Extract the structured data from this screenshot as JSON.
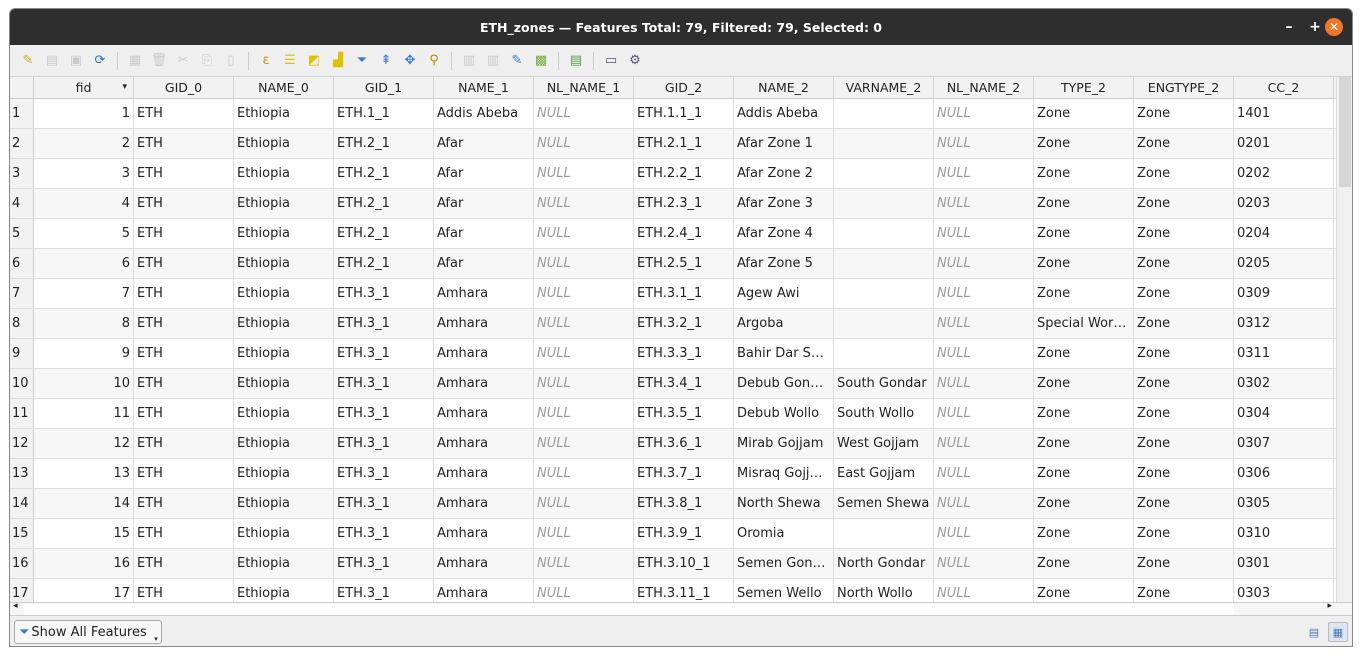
{
  "window": {
    "title": "ETH_zones — Features Total: 79, Filtered: 79, Selected: 0",
    "minimize": "–",
    "maximize": "+",
    "close": "✕"
  },
  "toolbar": [
    {
      "name": "toggle-editing-icon",
      "glyph": "✎",
      "color": "#d8b020",
      "enabled": true
    },
    {
      "name": "toggle-multi-edit-icon",
      "glyph": "▤",
      "color": "#888",
      "enabled": false
    },
    {
      "name": "save-edits-icon",
      "glyph": "▣",
      "color": "#888",
      "enabled": false
    },
    {
      "name": "reload-icon",
      "glyph": "⟳",
      "color": "#2e6fc7",
      "enabled": true
    },
    {
      "sep": true
    },
    {
      "name": "add-feature-icon",
      "glyph": "▦",
      "color": "#888",
      "enabled": false
    },
    {
      "name": "delete-selected-icon",
      "glyph": "🗑",
      "color": "#888",
      "enabled": false
    },
    {
      "name": "cut-icon",
      "glyph": "✂",
      "color": "#888",
      "enabled": false
    },
    {
      "name": "copy-icon",
      "glyph": "⎘",
      "color": "#888",
      "enabled": false
    },
    {
      "name": "paste-icon",
      "glyph": "▯",
      "color": "#888",
      "enabled": false
    },
    {
      "sep": true
    },
    {
      "name": "select-by-expression-icon",
      "glyph": "ε",
      "color": "#c89a00",
      "enabled": true
    },
    {
      "name": "select-all-icon",
      "glyph": "☰",
      "color": "#e0c000",
      "enabled": true
    },
    {
      "name": "invert-selection-icon",
      "glyph": "◩",
      "color": "#e0c000",
      "enabled": true
    },
    {
      "name": "deselect-all-icon",
      "glyph": "▟",
      "color": "#e0c000",
      "enabled": true
    },
    {
      "name": "filter-icon",
      "glyph": "⏷",
      "color": "#3a7ad0",
      "enabled": true
    },
    {
      "name": "move-selection-top-icon",
      "glyph": "⇞",
      "color": "#3a7ad0",
      "enabled": true
    },
    {
      "name": "pan-to-selected-icon",
      "glyph": "✥",
      "color": "#3a7ad0",
      "enabled": true
    },
    {
      "name": "zoom-to-selected-icon",
      "glyph": "⚲",
      "color": "#b08a00",
      "enabled": true
    },
    {
      "sep": true
    },
    {
      "name": "new-field-icon",
      "glyph": "▥",
      "color": "#888",
      "enabled": false
    },
    {
      "name": "delete-field-icon",
      "glyph": "▥",
      "color": "#888",
      "enabled": false
    },
    {
      "name": "organize-columns-icon",
      "glyph": "✎",
      "color": "#3a7ad0",
      "enabled": true
    },
    {
      "name": "field-calculator-icon",
      "glyph": "▩",
      "color": "#7a4",
      "enabled": true
    },
    {
      "sep": true
    },
    {
      "name": "conditional-formatting-icon",
      "glyph": "▤",
      "color": "#5a9a50",
      "enabled": true
    },
    {
      "sep": true
    },
    {
      "name": "dock-icon",
      "glyph": "▭",
      "color": "#557",
      "enabled": true
    },
    {
      "name": "actions-icon",
      "glyph": "⚙",
      "color": "#557",
      "enabled": true
    }
  ],
  "columns": [
    "fid",
    "GID_0",
    "NAME_0",
    "GID_1",
    "NAME_1",
    "NL_NAME_1",
    "GID_2",
    "NAME_2",
    "VARNAME_2",
    "NL_NAME_2",
    "TYPE_2",
    "ENGTYPE_2",
    "CC_2"
  ],
  "rows": [
    [
      "1",
      "1",
      "ETH",
      "Ethiopia",
      "ETH.1_1",
      "Addis Abeba",
      "NULL",
      "ETH.1.1_1",
      "Addis Abeba",
      "",
      "NULL",
      "Zone",
      "Zone",
      "1401"
    ],
    [
      "2",
      "2",
      "ETH",
      "Ethiopia",
      "ETH.2_1",
      "Afar",
      "NULL",
      "ETH.2.1_1",
      "Afar Zone 1",
      "",
      "NULL",
      "Zone",
      "Zone",
      "0201"
    ],
    [
      "3",
      "3",
      "ETH",
      "Ethiopia",
      "ETH.2_1",
      "Afar",
      "NULL",
      "ETH.2.2_1",
      "Afar Zone 2",
      "",
      "NULL",
      "Zone",
      "Zone",
      "0202"
    ],
    [
      "4",
      "4",
      "ETH",
      "Ethiopia",
      "ETH.2_1",
      "Afar",
      "NULL",
      "ETH.2.3_1",
      "Afar Zone 3",
      "",
      "NULL",
      "Zone",
      "Zone",
      "0203"
    ],
    [
      "5",
      "5",
      "ETH",
      "Ethiopia",
      "ETH.2_1",
      "Afar",
      "NULL",
      "ETH.2.4_1",
      "Afar Zone 4",
      "",
      "NULL",
      "Zone",
      "Zone",
      "0204"
    ],
    [
      "6",
      "6",
      "ETH",
      "Ethiopia",
      "ETH.2_1",
      "Afar",
      "NULL",
      "ETH.2.5_1",
      "Afar Zone 5",
      "",
      "NULL",
      "Zone",
      "Zone",
      "0205"
    ],
    [
      "7",
      "7",
      "ETH",
      "Ethiopia",
      "ETH.3_1",
      "Amhara",
      "NULL",
      "ETH.3.1_1",
      "Agew Awi",
      "",
      "NULL",
      "Zone",
      "Zone",
      "0309"
    ],
    [
      "8",
      "8",
      "ETH",
      "Ethiopia",
      "ETH.3_1",
      "Amhara",
      "NULL",
      "ETH.3.2_1",
      "Argoba",
      "",
      "NULL",
      "Special Wor…",
      "Zone",
      "0312"
    ],
    [
      "9",
      "9",
      "ETH",
      "Ethiopia",
      "ETH.3_1",
      "Amhara",
      "NULL",
      "ETH.3.3_1",
      "Bahir Dar S…",
      "",
      "NULL",
      "Zone",
      "Zone",
      "0311"
    ],
    [
      "10",
      "10",
      "ETH",
      "Ethiopia",
      "ETH.3_1",
      "Amhara",
      "NULL",
      "ETH.3.4_1",
      "Debub Gon…",
      "South Gondar",
      "NULL",
      "Zone",
      "Zone",
      "0302"
    ],
    [
      "11",
      "11",
      "ETH",
      "Ethiopia",
      "ETH.3_1",
      "Amhara",
      "NULL",
      "ETH.3.5_1",
      "Debub Wollo",
      "South Wollo",
      "NULL",
      "Zone",
      "Zone",
      "0304"
    ],
    [
      "12",
      "12",
      "ETH",
      "Ethiopia",
      "ETH.3_1",
      "Amhara",
      "NULL",
      "ETH.3.6_1",
      "Mirab Gojjam",
      "West Gojjam",
      "NULL",
      "Zone",
      "Zone",
      "0307"
    ],
    [
      "13",
      "13",
      "ETH",
      "Ethiopia",
      "ETH.3_1",
      "Amhara",
      "NULL",
      "ETH.3.7_1",
      "Misraq Gojj…",
      "East Gojjam",
      "NULL",
      "Zone",
      "Zone",
      "0306"
    ],
    [
      "14",
      "14",
      "ETH",
      "Ethiopia",
      "ETH.3_1",
      "Amhara",
      "NULL",
      "ETH.3.8_1",
      "North Shewa",
      "Semen Shewa",
      "NULL",
      "Zone",
      "Zone",
      "0305"
    ],
    [
      "15",
      "15",
      "ETH",
      "Ethiopia",
      "ETH.3_1",
      "Amhara",
      "NULL",
      "ETH.3.9_1",
      "Oromia",
      "",
      "NULL",
      "Zone",
      "Zone",
      "0310"
    ],
    [
      "16",
      "16",
      "ETH",
      "Ethiopia",
      "ETH.3_1",
      "Amhara",
      "NULL",
      "ETH.3.10_1",
      "Semen Gon…",
      "North Gondar",
      "NULL",
      "Zone",
      "Zone",
      "0301"
    ],
    [
      "17",
      "17",
      "ETH",
      "Ethiopia",
      "ETH.3_1",
      "Amhara",
      "NULL",
      "ETH.3.11_1",
      "Semen Wello",
      "North Wollo",
      "NULL",
      "Zone",
      "Zone",
      "0303"
    ]
  ],
  "footer": {
    "show_all": "Show All Features",
    "form_view": "form-view-icon",
    "table_view": "table-view-icon"
  }
}
